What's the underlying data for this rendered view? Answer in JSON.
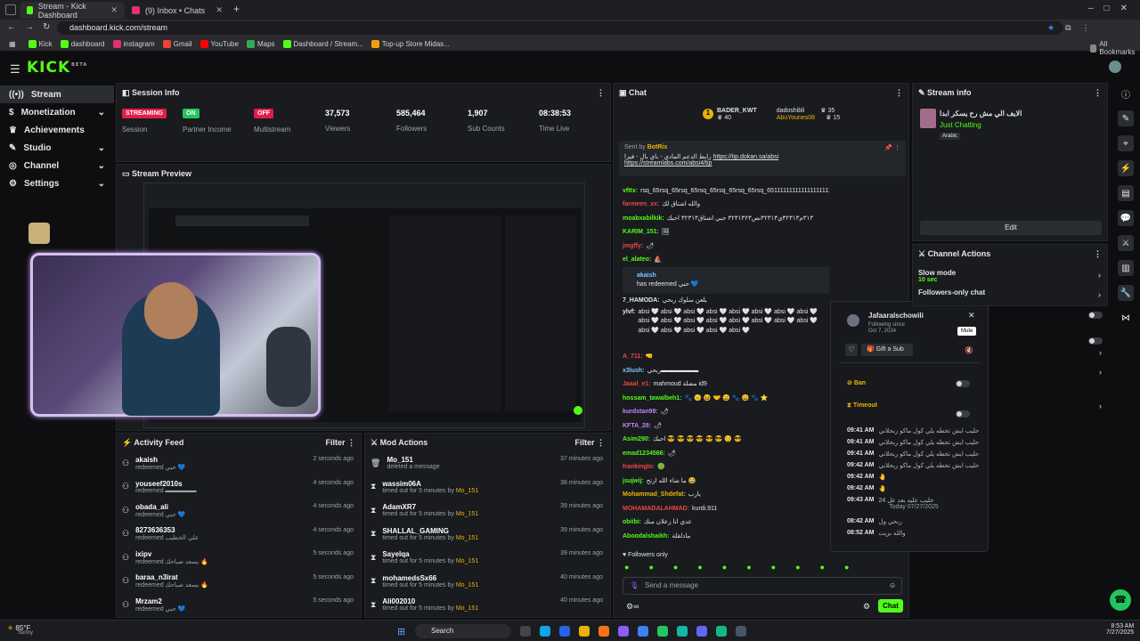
{
  "browser": {
    "tabs": [
      {
        "title": "Stream - Kick Dashboard",
        "color": "#53fc18"
      },
      {
        "title": "(9) Inbox • Chats",
        "color": "#e1306c"
      }
    ],
    "url": "dashboard.kick.com/stream",
    "bookmarks": [
      "Kick",
      "dashboard",
      "instagram",
      "Gmail",
      "YouTube",
      "Maps",
      "Dashboard / Stream...",
      "Top-up Store Midas...",
      "All Bookmarks"
    ]
  },
  "app": {
    "logo": "KICK",
    "logo_tag": "BETA",
    "accent": "#53fc18"
  },
  "sidebar": {
    "items": [
      {
        "label": "Stream"
      },
      {
        "label": "Monetization"
      },
      {
        "label": "Achievements"
      },
      {
        "label": "Studio"
      },
      {
        "label": "Channel"
      },
      {
        "label": "Settings"
      }
    ]
  },
  "session": {
    "title": "Session Info",
    "stats": [
      {
        "value": "STREAMING",
        "label": "Session",
        "badge_color": "#e11d48"
      },
      {
        "value": "ON",
        "label": "Partner Income",
        "badge_color": "#22c55e"
      },
      {
        "value": "OFF",
        "label": "Multistream",
        "badge_color": "#e11d48"
      },
      {
        "value": "37,573",
        "label": "Viewers"
      },
      {
        "value": "585,464",
        "label": "Followers"
      },
      {
        "value": "1,907",
        "label": "Sub Counts"
      },
      {
        "value": "08:38:53",
        "label": "Time Live"
      }
    ]
  },
  "preview": {
    "title": "Stream Preview"
  },
  "activity": {
    "title": "Activity Feed",
    "filter": "Filter",
    "items": [
      {
        "name": "akaish",
        "sub": "redeemed حبي 💙",
        "time": "2 seconds ago"
      },
      {
        "name": "youseef2010s",
        "sub": "redeemed ▬▬▬▬▬",
        "time": "4 seconds ago"
      },
      {
        "name": "obada_ali",
        "sub": "redeemed حبي 💙",
        "time": "4 seconds ago"
      },
      {
        "name": "8273636353",
        "sub": "redeemed علي الخطيب",
        "time": "4 seconds ago"
      },
      {
        "name": "ixipv",
        "sub": "redeemed يسعد صباحك 🔥",
        "time": "5 seconds ago"
      },
      {
        "name": "baraa_n3irat",
        "sub": "redeemed يسعد صباحك 🔥",
        "time": "5 seconds ago"
      },
      {
        "name": "Mrzam2",
        "sub": "redeemed حبي 💙",
        "time": "5 seconds ago"
      }
    ]
  },
  "mod": {
    "title": "Mod Actions",
    "filter": "Filter",
    "items": [
      {
        "name": "Mo_151",
        "sub": "deleted a message",
        "by": "",
        "time": "37 minutes ago"
      },
      {
        "name": "wassim06A",
        "sub": "timed out for 5 minutes by",
        "by": "Mo_151",
        "time": "38 minutes ago"
      },
      {
        "name": "AdamXR7",
        "sub": "timed out for 5 minutes by",
        "by": "Mo_151",
        "time": "39 minutes ago"
      },
      {
        "name": "SHALLAL_GAMING",
        "sub": "timed out for 5 minutes by",
        "by": "Mo_151",
        "time": "39 minutes ago"
      },
      {
        "name": "Sayelqa",
        "sub": "timed out for 5 minutes by",
        "by": "Mo_151",
        "time": "39 minutes ago"
      },
      {
        "name": "mohamedsSx66",
        "sub": "timed out for 5 minutes by",
        "by": "Mo_151",
        "time": "40 minutes ago"
      },
      {
        "name": "Ali002010",
        "sub": "timed out for 5 minutes by",
        "by": "Mo_151",
        "time": "40 minutes ago"
      }
    ]
  },
  "chat": {
    "title": "Chat",
    "leaders": [
      {
        "name": "BADER_KWT",
        "count": "40"
      },
      {
        "name": "dadoshibli",
        "count": "35"
      },
      {
        "name": "AbuYounes08",
        "count": "15"
      }
    ],
    "pinned": {
      "sent_by": "Sent by",
      "bot": "BotRix",
      "text": "رابط الدعم المادي - باي بال - فيزا",
      "link1": "https://tip.dokan.sa/absi",
      "link2": "https://streamlabs.com/absi4/tip"
    },
    "messages": [
      {
        "user": "vfttx:",
        "color": "#53fc18",
        "text": "rsq_65rsq_65rsq_65rsq_65rsq_65rsq_65rsq_651111111111111111111111111111111"
      },
      {
        "user": "farmeen_xx:",
        "color": "#ef4444",
        "text": "والله اشتاق لك"
      },
      {
        "user": "moabxabilkik:",
        "color": "#53fc18",
        "text": "٣١٣م٣٢٣١٣ي٣٢٣١٣نص٣٢٣١٣٢٣ حبي اشتاق٣٢٣١٣ احبك"
      },
      {
        "user": "KARIM_151:",
        "color": "#53fc18",
        "text": "🖼"
      },
      {
        "user": "jmgffy:",
        "color": "#ef4444",
        "text": "🌶"
      },
      {
        "user": "el_alateo:",
        "color": "#53fc18",
        "text": "⛵"
      },
      {
        "user": "akaish",
        "color": "#7cc8ff",
        "text": "has redeemed حبي 💙"
      },
      {
        "user": "7_HAMODA:",
        "color": "#e6e6e6",
        "text": "يلعن سلوك ربحي"
      },
      {
        "user": "ylvf:",
        "color": "#e6e6e6",
        "text": "absi 🤍 absi 🤍 absi 🤍 absi 🤍 absi 🤍 absi 🤍 absi 🤍 absi 🤍 absi 🤍 absi 🤍 absi 🤍 absi 🤍 absi 🤍 absi 🤍 absi 🤍 absi 🤍 absi 🤍 absi 🤍 absi 🤍 absi 🤍 absi 🤍"
      },
      {
        "user": "A_711:",
        "color": "#ef4444",
        "text": "🤜"
      },
      {
        "user": "x3lush:",
        "color": "#7cc8ff",
        "text": "ربحي▬▬▬▬▬▬"
      },
      {
        "user": "Jaaal_e1:",
        "color": "#ef4444",
        "text": "mahmoud  مضلة  id9"
      },
      {
        "user": "hossam_tawalbeh1:",
        "color": "#53fc18",
        "text": "🐾 😐 😆 🤝 😀 🐾 😀 🐾 ⭐"
      },
      {
        "user": "kurdstan99:",
        "color": "#c084fc",
        "text": "🌶"
      },
      {
        "user": "KFTA_28:",
        "color": "#c084fc",
        "text": "🌶"
      },
      {
        "user": "Asim290:",
        "color": "#53fc18",
        "text": "احبك 😎 😎 😎 😎 😎 😎 😊 😎"
      },
      {
        "user": "emad1234566:",
        "color": "#53fc18",
        "text": "🌶"
      },
      {
        "user": "frankinglo:",
        "color": "#ef4444",
        "text": "🟢"
      },
      {
        "user": "jsujwij:",
        "color": "#53fc18",
        "text": "ما شاء الله ارتح 😂"
      },
      {
        "user": "Mohammad_Shdefat:",
        "color": "#eab308",
        "text": "يارب"
      },
      {
        "user": "MOHAMADALAHMAD:",
        "color": "#ef4444",
        "text": "kurdi.911"
      },
      {
        "user": "obiibi:",
        "color": "#53fc18",
        "text": "عدي انا زعلان منك"
      },
      {
        "user": "Aboodalshaikh:",
        "color": "#53fc18",
        "text": "مادلقلة"
      }
    ],
    "followers_only": "Followers only",
    "input_placeholder": "Send a message",
    "send_label": "Chat"
  },
  "popup": {
    "username": "Jafaaralschowili",
    "following_since": "Following since",
    "date": "Oct 7, 2024",
    "gift": "Gift a Sub",
    "mute_tooltip": "Mute",
    "ban": "Ban",
    "timeout": "Timeout",
    "messages": [
      {
        "time": "09:41 AM",
        "text": "حليب ايش تحطه يلي كول ماكو ربحلاني"
      },
      {
        "time": "09:41 AM",
        "text": "حليب ايش تحطه يلي كول ماكو ربحلاني"
      },
      {
        "time": "09:41 AM",
        "text": "حليب ايش تحطه يلي كول ماكو ربحلاني"
      },
      {
        "time": "09:42 AM",
        "text": "حليب ايش تحطه يلي كول ماكو ربحلاني"
      },
      {
        "time": "09:42 AM",
        "text": "🤚"
      },
      {
        "time": "09:42 AM",
        "text": "🤚"
      },
      {
        "time": "09:43 AM",
        "text": "حليب عليه بعد عل 24"
      }
    ],
    "today_label": "Today 07/27/2025",
    "today_messages": [
      {
        "time": "08:42 AM",
        "text": "ربحي ول"
      },
      {
        "time": "08:52 AM",
        "text": "والله بزيت"
      }
    ]
  },
  "stream_info": {
    "title": "Stream info",
    "stream_title": "الايف الي مش رح يسكر ابدا",
    "category": "Just Chatting",
    "language": "Arabic",
    "edit": "Edit"
  },
  "channel_actions": {
    "title": "Channel Actions",
    "items": [
      {
        "label": "Slow mode",
        "sub": "10 sec"
      },
      {
        "label": "Followers-only chat",
        "sub": ""
      }
    ]
  },
  "taskbar": {
    "temp": "85°F",
    "weather": "Sunny",
    "search": "Search",
    "time": "8:53 AM",
    "date": "7/27/2025"
  }
}
